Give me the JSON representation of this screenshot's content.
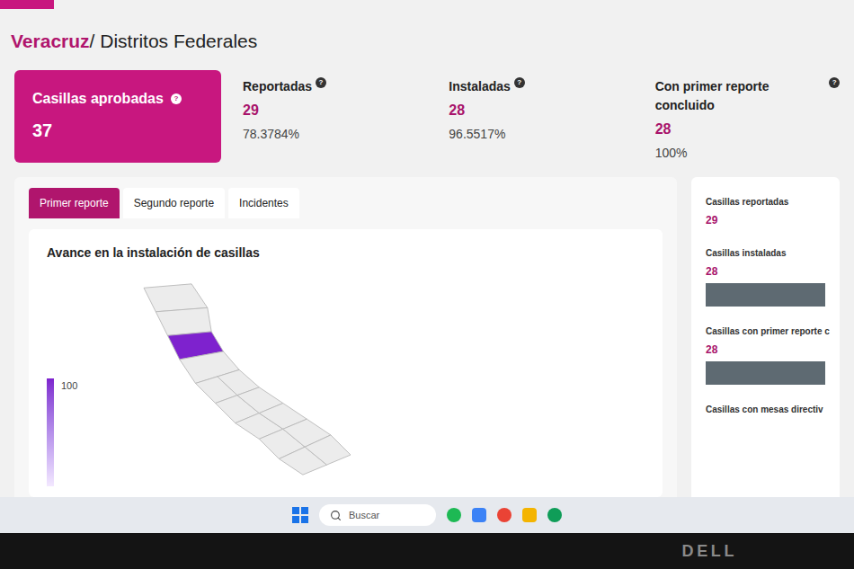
{
  "breadcrumb": {
    "state": "Veracruz",
    "section": "/ Distritos Federales"
  },
  "approved": {
    "label": "Casillas aprobadas",
    "help": "?",
    "value": "37"
  },
  "stats": [
    {
      "label": "Reportadas",
      "help": "?",
      "value": "29",
      "percent": "78.3784%"
    },
    {
      "label": "Instaladas",
      "help": "?",
      "value": "28",
      "percent": "96.5517%"
    },
    {
      "label": "Con primer reporte concluido",
      "help": "?",
      "value": "28",
      "percent": "100%"
    }
  ],
  "tabs": [
    {
      "label": "Primer reporte",
      "selected": true
    },
    {
      "label": "Segundo reporte",
      "selected": false
    },
    {
      "label": "Incidentes",
      "selected": false
    }
  ],
  "map": {
    "title": "Avance en la instalación de casillas",
    "legend_max": "100",
    "districts": [
      0,
      0,
      1,
      0,
      0,
      0,
      0,
      0,
      0,
      0,
      0,
      0,
      0,
      0
    ]
  },
  "side_panel": {
    "items": [
      {
        "label": "Casillas reportadas",
        "value": "29",
        "kind": "plain"
      },
      {
        "label": "Casillas instaladas",
        "value": "28",
        "kind": "bar",
        "level": 1
      },
      {
        "label": "Casillas con primer reporte c",
        "value": "28",
        "kind": "bar",
        "level": 1
      },
      {
        "label": "Casillas con mesas directiv",
        "kind": "label"
      }
    ]
  },
  "taskbar": {
    "search_placeholder": "Buscar"
  },
  "monitor": {
    "brand": "DELL"
  }
}
